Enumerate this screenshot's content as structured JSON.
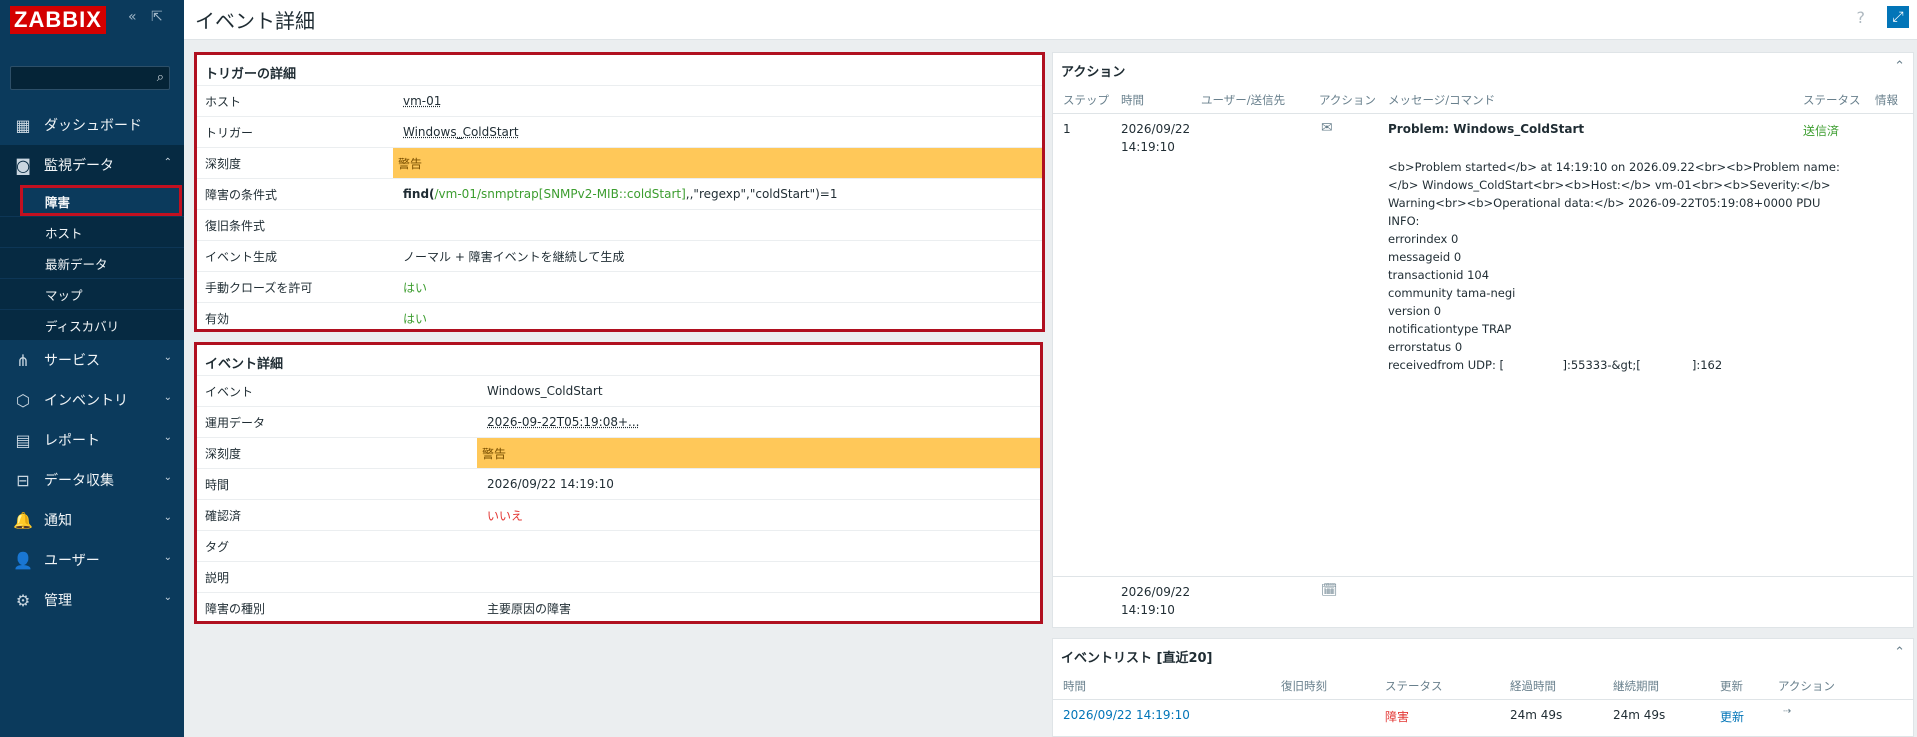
{
  "app": {
    "logo": "ZABBIX",
    "collapse_icon": "«",
    "undock_icon": "⇱"
  },
  "search": {
    "placeholder": "",
    "icon": "search-icon"
  },
  "sidebar": {
    "items": [
      {
        "label": "ダッシュボード",
        "icon": "dashboard-icon",
        "glyph": "▦"
      },
      {
        "label": "監視データ",
        "icon": "monitoring-icon",
        "glyph": "◙",
        "chev": "⌃"
      },
      {
        "label": "サービス",
        "icon": "services-icon",
        "glyph": "⋔",
        "chev": "⌄"
      },
      {
        "label": "インベントリ",
        "icon": "inventory-icon",
        "glyph": "⬡",
        "chev": "⌄"
      },
      {
        "label": "レポート",
        "icon": "reports-icon",
        "glyph": "▤",
        "chev": "⌄"
      },
      {
        "label": "データ収集",
        "icon": "data-collection-icon",
        "glyph": "⊟",
        "chev": "⌄"
      },
      {
        "label": "通知",
        "icon": "alerts-icon",
        "glyph": "🔔",
        "chev": "⌄"
      },
      {
        "label": "ユーザー",
        "icon": "users-icon",
        "glyph": "👤",
        "chev": "⌄"
      },
      {
        "label": "管理",
        "icon": "administration-icon",
        "glyph": "⚙",
        "chev": "⌄"
      }
    ],
    "submenu": [
      "障害",
      "ホスト",
      "最新データ",
      "マップ",
      "ディスカバリ"
    ]
  },
  "header": {
    "title": "イベント詳細",
    "help": "?",
    "fullscreen": "⤢"
  },
  "trigger": {
    "title": "トリガーの詳細",
    "rows": [
      {
        "k": "ホスト",
        "v": "vm-01"
      },
      {
        "k": "トリガー",
        "v": "Windows_ColdStart"
      },
      {
        "k": "深刻度",
        "v": "警告"
      },
      {
        "k": "障害の条件式",
        "v_a": "find(",
        "v_b": "/vm-01/snmptrap[SNMPv2-MIB::coldStart]",
        "v_c": ",,\"regexp\",\"coldStart\")=1"
      },
      {
        "k": "復旧条件式",
        "v": ""
      },
      {
        "k": "イベント生成",
        "v": "ノーマル + 障害イベントを継続して生成"
      },
      {
        "k": "手動クローズを許可",
        "v": "はい"
      },
      {
        "k": "有効",
        "v": "はい"
      }
    ]
  },
  "event": {
    "title": "イベント詳細",
    "rows": [
      {
        "k": "イベント",
        "v": "Windows_ColdStart"
      },
      {
        "k": "運用データ",
        "v": "2026-09-22T05:19:08+..."
      },
      {
        "k": "深刻度",
        "v": "警告"
      },
      {
        "k": "時間",
        "v": "2026/09/22 14:19:10"
      },
      {
        "k": "確認済",
        "v": "いいえ"
      },
      {
        "k": "タグ",
        "v": ""
      },
      {
        "k": "説明",
        "v": ""
      },
      {
        "k": "障害の種別",
        "v": "主要原因の障害"
      }
    ]
  },
  "actions": {
    "title": "アクション",
    "collapse": "⌃",
    "headers": [
      "ステップ",
      "時間",
      "ユーザー/送信先",
      "アクション",
      "メッセージ/コマンド",
      "ステータス",
      "情報"
    ],
    "row1": {
      "step": "1",
      "date": "2026/09/22",
      "time": "14:19:10",
      "action_icon": "mail-icon",
      "subject": "Problem: Windows_ColdStart",
      "status": "送信済",
      "body": [
        "<b>Problem started</b> at 14:19:10 on 2026.09.22<br><b>Problem name:",
        "</b> Windows_ColdStart<br><b>Host:</b> vm-01<br><b>Severity:</b>",
        "Warning<br><b>Operational data:</b> 2026-09-22T05:19:08+0000 PDU",
        "INFO:",
        "errorindex 0",
        "messageid 0",
        "transactionid 104",
        "community tama-negi",
        "version 0",
        "notificationtype TRAP",
        "errorstatus 0",
        "receivedfrom UDP: [                ]:55333-&gt;[              ]:162"
      ]
    },
    "row2": {
      "date": "2026/09/22",
      "time": "14:19:10",
      "action_icon": "calendar-icon"
    }
  },
  "eventlist": {
    "title": "イベントリスト [直近20]",
    "collapse": "⌃",
    "headers": [
      "時間",
      "復旧時刻",
      "ステータス",
      "経過時間",
      "継続期間",
      "更新",
      "アクション"
    ],
    "row": {
      "time": "2026/09/22 14:19:10",
      "recovery": "",
      "status": "障害",
      "age": "24m 49s",
      "duration": "24m 49s",
      "update": "更新",
      "action_icon": "actions-arrow-icon"
    }
  },
  "colors": {
    "sidebar": "#0b3a5c",
    "highlight": "#b01020",
    "severity_warning": "#ffc859",
    "accent": "#0275b8"
  }
}
